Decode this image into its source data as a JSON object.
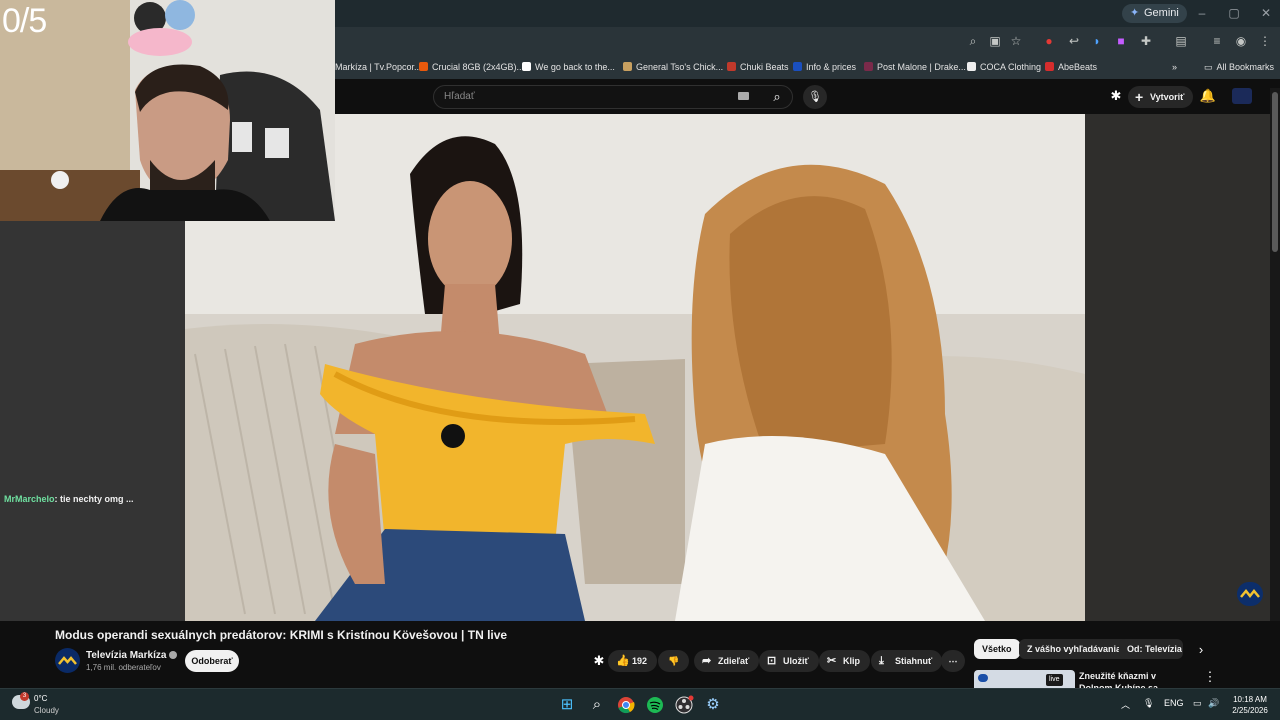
{
  "browser": {
    "gemini_label": "Gemini",
    "bookmarks": [
      {
        "label": "Markíza | Tv.Popcor...",
        "color": "#2a3439"
      },
      {
        "label": "Crucial 8GB (2x4GB)...",
        "color": "#e8590c"
      },
      {
        "label": "We go back to the...",
        "color": "#ffffff"
      },
      {
        "label": "General Tso's Chick...",
        "color": "#c8a060"
      },
      {
        "label": "Chuki Beats",
        "color": "#c0392b"
      },
      {
        "label": "Info & prices",
        "color": "#1a4fbf"
      },
      {
        "label": "Post Malone | Drake...",
        "color": "#7a2a4a"
      },
      {
        "label": "COCA Clothing",
        "color": "#222222"
      },
      {
        "label": "AbeBeats",
        "color": "#d62d2d"
      }
    ],
    "all_bookmarks_label": "All Bookmarks"
  },
  "youtube": {
    "search_placeholder": "Hľadať",
    "create_label": "Vytvoriť",
    "video_title": "Modus operandi sexuálnych predátorov: KRIMI s Kristínou Kövešovou | TN live",
    "channel_name": "Televízia Markíza",
    "subscribers": "1,76 mil. odberateľov",
    "subscribe_label": "Odoberať",
    "likes": "192",
    "actions": {
      "share": "Zdieľať",
      "save": "Uložiť",
      "clip": "Klip",
      "download": "Stiahnuť"
    },
    "chips": [
      "Všetko",
      "Z vášho vyhľadávania",
      "Od: Televízia M"
    ],
    "recommendation_title": "Zneužité kňazmi v Dolnom Kubíne sa dočkali",
    "recommendation_badge": "live"
  },
  "overlay": {
    "counter": "0/5",
    "chat_user": "MrMarchelo",
    "chat_message": ": tie nechty omg ..."
  },
  "taskbar": {
    "temperature": "0°C",
    "condition": "Cloudy",
    "weather_badge": "3",
    "language": "ENG",
    "time": "10:18 AM",
    "date": "2/25/2026"
  }
}
